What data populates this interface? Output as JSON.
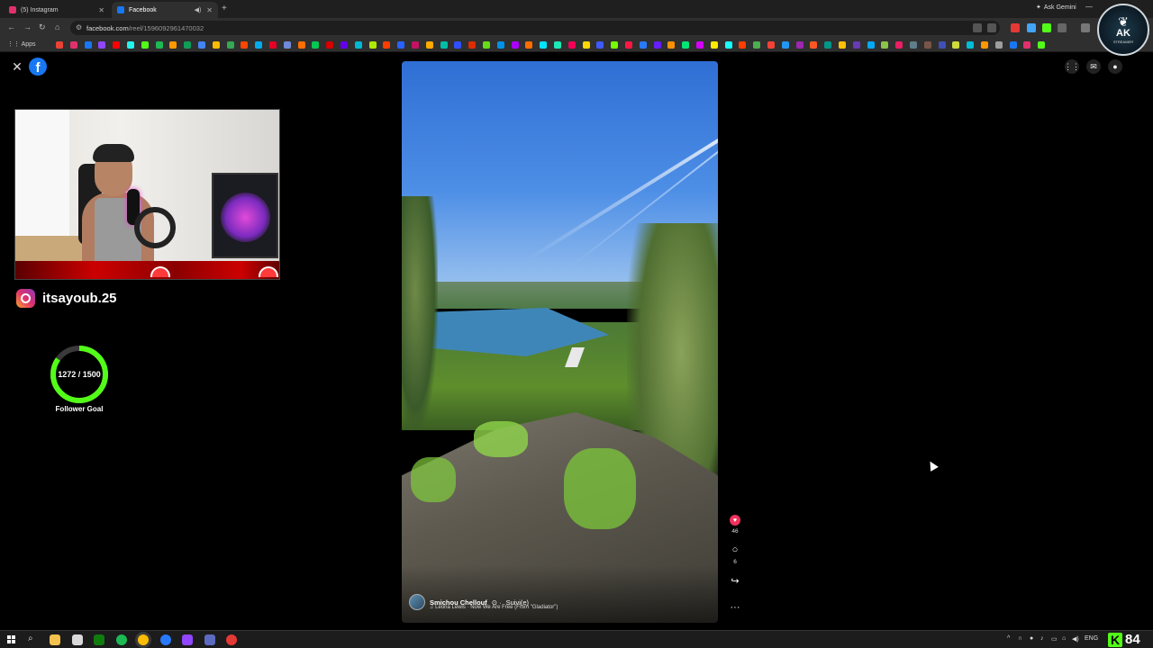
{
  "browser": {
    "tabs": [
      {
        "label": "(5) Instagram",
        "active": false,
        "favicon_color": "#e1306c"
      },
      {
        "label": "Facebook",
        "active": true,
        "favicon_color": "#1877f2"
      }
    ],
    "new_tab": "+",
    "url_domain": "facebook.com",
    "url_path": "/reel/1596092961470032",
    "ask_gemini": "Ask Gemini",
    "bookmarks_apps": "Apps",
    "bookmark_colors": [
      "#ea4335",
      "#e1306c",
      "#1877f2",
      "#9146ff",
      "#ff0000",
      "#25f4ee",
      "#53fc18",
      "#1db954",
      "#ff9900",
      "#0f9d58",
      "#4285f4",
      "#fbbc05",
      "#34a853",
      "#ff4500",
      "#00acee",
      "#e60023",
      "#7289da",
      "#ff6f00",
      "#00c853",
      "#d50000",
      "#6200ea",
      "#00b8d4",
      "#aeea00",
      "#ff3d00",
      "#2962ff",
      "#c51162",
      "#ffab00",
      "#00bfa5",
      "#304ffe",
      "#dd2c00",
      "#64dd17",
      "#0091ea",
      "#aa00ff",
      "#ff6d00",
      "#00e5ff",
      "#1de9b6",
      "#f50057",
      "#ffd600",
      "#3d5afe",
      "#76ff03",
      "#ff1744",
      "#2979ff",
      "#651fff",
      "#ff9100",
      "#00e676",
      "#d500f9",
      "#ffea00",
      "#18ffff",
      "#ff3d00",
      "#4caf50",
      "#f44336",
      "#2196f3",
      "#9c27b0",
      "#ff5722",
      "#009688",
      "#ffc107",
      "#673ab7",
      "#03a9f4",
      "#8bc34a",
      "#e91e63",
      "#607d8b",
      "#795548",
      "#3f51b5",
      "#cddc39",
      "#00bcd4",
      "#ff9800",
      "#9e9e9e",
      "#1877f2",
      "#e1306c",
      "#53fc18"
    ]
  },
  "facebook": {
    "close": "✕",
    "logo": "f",
    "right_icons": [
      "grid-icon",
      "messenger-icon",
      "bell-icon",
      "profile-icon"
    ]
  },
  "stream_overlay": {
    "instagram_handle": "itsayoub.25",
    "follower_goal": {
      "current": 1272,
      "target": 1500,
      "text": "1272 / 1500",
      "label": "Follower Goal",
      "color": "#53fc18"
    }
  },
  "reel": {
    "author": "Smichou Chellouf",
    "follow_status": "Suivi(e)",
    "music": "♫ Leona Lewis · Now We Are Free (From \"Gladiator\")",
    "likes": "46",
    "comments": "6",
    "more": "···"
  },
  "badge": {
    "title": "AK",
    "subtitle": "STREAMER"
  },
  "taskbar": {
    "language": "ENG",
    "kick_count": "84"
  }
}
